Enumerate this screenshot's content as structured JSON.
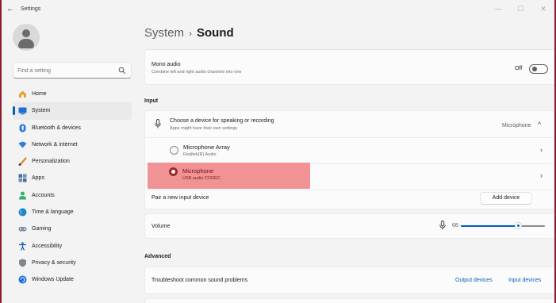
{
  "window": {
    "title": "Settings",
    "back_glyph": "←",
    "min_glyph": "—",
    "max_glyph": "☐",
    "close_glyph": "✕"
  },
  "search": {
    "placeholder": "Find a setting",
    "value": ""
  },
  "sidebar": {
    "items": [
      {
        "label": "Home",
        "icon": "home-icon",
        "color": "#e8a03a"
      },
      {
        "label": "System",
        "icon": "system-icon",
        "color": "#1e6fd1",
        "active": true
      },
      {
        "label": "Bluetooth & devices",
        "icon": "bluetooth-icon",
        "color": "#1f6fe0"
      },
      {
        "label": "Network & internet",
        "icon": "wifi-icon",
        "color": "#2a7fd9"
      },
      {
        "label": "Personalization",
        "icon": "brush-icon",
        "color": "#d98a2a"
      },
      {
        "label": "Apps",
        "icon": "apps-icon",
        "color": "#4a6f9e"
      },
      {
        "label": "Accounts",
        "icon": "accounts-icon",
        "color": "#2bb065"
      },
      {
        "label": "Time & language",
        "icon": "globe-clock-icon",
        "color": "#1f86c9"
      },
      {
        "label": "Gaming",
        "icon": "gamepad-icon",
        "color": "#7f8fa6"
      },
      {
        "label": "Accessibility",
        "icon": "accessibility-icon",
        "color": "#1656b8"
      },
      {
        "label": "Privacy & security",
        "icon": "shield-icon",
        "color": "#7e8790"
      },
      {
        "label": "Windows Update",
        "icon": "update-icon",
        "color": "#1873d6"
      }
    ]
  },
  "breadcrumb": {
    "parent": "System",
    "separator": "›",
    "current": "Sound"
  },
  "mono_audio": {
    "title": "Mono audio",
    "subtitle": "Combine left and right audio channels into one",
    "state_label": "Off"
  },
  "input": {
    "section_label": "Input",
    "choose": {
      "title": "Choose a device for speaking or recording",
      "subtitle": "Apps might have their own settings",
      "selected": "Microphone",
      "chevron": "^"
    },
    "devices": [
      {
        "name": "Microphone Array",
        "detail": "Realtek(R) Audio",
        "selected": false
      },
      {
        "name": "Microphone",
        "detail": "USB audio CODEC",
        "selected": true
      }
    ],
    "pair": {
      "label": "Pair a new input device",
      "button": "Add device"
    },
    "volume": {
      "label": "Volume",
      "value": "68",
      "level": 0.68
    }
  },
  "advanced": {
    "section_label": "Advanced",
    "troubleshoot": {
      "label": "Troubleshoot common sound problems",
      "link1": "Output devices",
      "link2": "Input devices"
    }
  },
  "chevron_right": "›",
  "colors": {
    "accent": "#005fb8",
    "highlight": "#f08a8c",
    "selected_radio": "#9b2a2a"
  }
}
